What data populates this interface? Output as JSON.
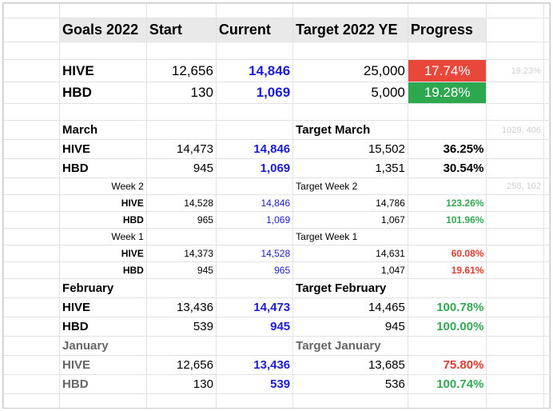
{
  "header": {
    "goals": "Goals 2022",
    "start": "Start",
    "current": "Current",
    "target": "Target 2022 YE",
    "progress": "Progress"
  },
  "ye": [
    {
      "label": "HIVE",
      "start": "12,656",
      "current": "14,846",
      "target": "25,000",
      "progress": "17.74%",
      "progress_status": "red"
    },
    {
      "label": "HBD",
      "start": "130",
      "current": "1,069",
      "target": "5,000",
      "progress": "19.28%",
      "progress_status": "green"
    }
  ],
  "ye_side_note": "19.23%",
  "march": {
    "label": "March",
    "target_label": "Target March",
    "side_note": "1029, 406",
    "rows": [
      {
        "label": "HIVE",
        "start": "14,473",
        "current": "14,846",
        "target": "15,502",
        "progress": "36.25%"
      },
      {
        "label": "HBD",
        "start": "945",
        "current": "1,069",
        "target": "1,351",
        "progress": "30.54%"
      }
    ]
  },
  "week2": {
    "label": "Week 2",
    "target_label": "Target Week 2",
    "side_note": "258, 102",
    "rows": [
      {
        "label": "HIVE",
        "start": "14,528",
        "current": "14,846",
        "target": "14,786",
        "progress": "123.26%",
        "color": "green"
      },
      {
        "label": "HBD",
        "start": "965",
        "current": "1,069",
        "target": "1,067",
        "progress": "101.96%",
        "color": "green"
      }
    ]
  },
  "week1": {
    "label": "Week 1",
    "target_label": "Target Week 1",
    "rows": [
      {
        "label": "HIVE",
        "start": "14,373",
        "current": "14,528",
        "target": "14,631",
        "progress": "60.08%",
        "color": "red"
      },
      {
        "label": "HBD",
        "start": "945",
        "current": "965",
        "target": "1,047",
        "progress": "19.61%",
        "color": "red"
      }
    ]
  },
  "february": {
    "label": "February",
    "target_label": "Target February",
    "rows": [
      {
        "label": "HIVE",
        "start": "13,436",
        "current": "14,473",
        "target": "14,465",
        "progress": "100.78%",
        "color": "green"
      },
      {
        "label": "HBD",
        "start": "539",
        "current": "945",
        "target": "945",
        "progress": "100.00%",
        "color": "green"
      }
    ]
  },
  "january": {
    "label": "January",
    "target_label": "Target January",
    "rows": [
      {
        "label": "HIVE",
        "start": "12,656",
        "current": "13,436",
        "target": "13,685",
        "progress": "75.80%",
        "color": "red"
      },
      {
        "label": "HBD",
        "start": "130",
        "current": "539",
        "target": "536",
        "progress": "100.74%",
        "color": "green"
      }
    ]
  },
  "colors": {
    "accent_blue": "#1c1cd6",
    "red": "#e8473a",
    "green": "#2ea84f",
    "header_bg": "#e9e9e9"
  }
}
